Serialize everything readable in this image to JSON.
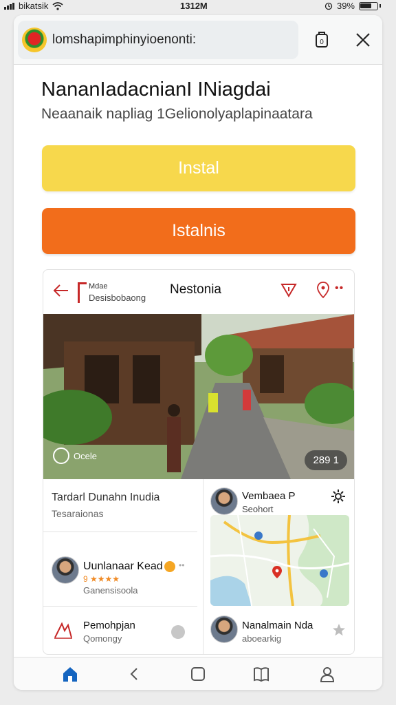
{
  "status_bar": {
    "carrier": "bikatsik",
    "time": "1312M",
    "battery": "39%"
  },
  "browser": {
    "url": "lomshapimphinyioenonti:",
    "tab_count": "0"
  },
  "page": {
    "headline": "NananIadacnianI INiagdai",
    "subheadline": "Neaanaik napliag 1Gelionolyaplapinaatara"
  },
  "buttons": {
    "install": "Instal",
    "istalne": "Istalnis"
  },
  "app_card": {
    "brand_line1": "Mdae",
    "brand_line2": "Desisbobaong",
    "title": "Nestonia",
    "photo": {
      "caption": "Ocele",
      "count": "289 1"
    },
    "place": {
      "title": "Tardarl Dunahn Inudia",
      "subtitle": "Tesaraionas"
    },
    "reviewer": {
      "name": "Uunlanaar Kead",
      "stars": "9 ★★★★",
      "subtitle": "Ganensisoola"
    },
    "bottom_item": {
      "title": "Pemohpjan",
      "subtitle": "Qomongy"
    },
    "map_card": {
      "title": "Vembaea P",
      "subtitle": "Seohort",
      "footer_title": "Nanalmain Nda",
      "footer_subtitle": "aboearkig"
    }
  },
  "colors": {
    "install": "#f7d84c",
    "istalne": "#f26d1b",
    "accent_red": "#c62828",
    "nav_blue": "#1565c0"
  },
  "icons": [
    "wifi-icon",
    "signal-bars-icon",
    "alarm-icon",
    "battery-icon",
    "tab-switcher-icon",
    "close-icon",
    "back-arrow-icon",
    "filter-icon",
    "location-pin-icon",
    "more-icon",
    "rating-star-icon",
    "home-icon",
    "back-icon",
    "square-icon",
    "bookmarks-icon",
    "profile-icon"
  ]
}
